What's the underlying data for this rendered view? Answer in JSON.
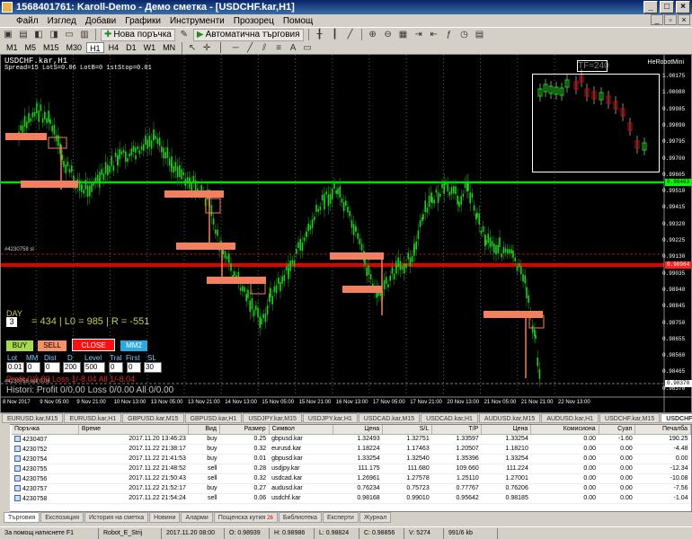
{
  "window": {
    "title": "1568401761: Karoll-Demo - Демо сметка - [USDCHF.kar,H1]"
  },
  "menu": [
    "Файл",
    "Изглед",
    "Добави",
    "Графики",
    "Инструменти",
    "Прозорец",
    "Помощ"
  ],
  "toolbar": {
    "new_order": "Нова поръчка",
    "auto_trading": "Автоматична търговия"
  },
  "timeframes": [
    "M1",
    "M5",
    "M15",
    "M30",
    "H1",
    "H4",
    "D1",
    "W1",
    "MN"
  ],
  "active_timeframe": "H1",
  "chart": {
    "title": "USDCHF.kar,H1",
    "spread_info": "Spread=15  LotS=0.06  LotB=0  1stStop=0.01",
    "robot_name": "HeRobotMini",
    "tf_box": "TF=240",
    "order_tag": "#4230758 sl",
    "order_tag2": "#4230758 sell 0.06",
    "day_label": "DAY",
    "day_value": "3",
    "stats": "= 434 | L0 = 985 | R = -551",
    "buttons": {
      "buy": "BUY",
      "sell": "SELL",
      "close": "CLOSE",
      "mm2": "MM2"
    },
    "params": [
      {
        "label": "Lot",
        "value": "0.01"
      },
      {
        "label": "MM",
        "value": "0"
      },
      {
        "label": "Dist",
        "value": "0"
      },
      {
        "label": "D",
        "value": "200"
      },
      {
        "label": "Level",
        "value": "500"
      },
      {
        "label": "Tral",
        "value": "0"
      },
      {
        "label": "First",
        "value": "0"
      },
      {
        "label": "SL",
        "value": "30"
      }
    ],
    "profit_line": "Profit 0/0.80  Loss 1/-8.04  All 1/-8.04",
    "history_line": "Histori: Profit 0/0.00  Loss 0/0.00  All 0/0.00",
    "price_labels": [
      "1.00175",
      "1.00080",
      "0.99985",
      "0.99890",
      "0.99795",
      "0.99700",
      "0.99605",
      "0.99510",
      "0.99415",
      "0.99320",
      "0.99225",
      "0.99130",
      "0.99035",
      "0.98940",
      "0.98845",
      "0.98750",
      "0.98655",
      "0.98560",
      "0.98465",
      "0.98370"
    ],
    "green_price": "0.99463",
    "red_price": "0.98964",
    "last_price": "0.98370",
    "date_labels": [
      "8 Nov 2017",
      "9 Nov 05:00",
      "9 Nov 21:00",
      "10 Nov 13:00",
      "13 Nov 05:00",
      "13 Nov 21:00",
      "14 Nov 13:00",
      "15 Nov 05:00",
      "15 Nov 21:00",
      "16 Nov 13:00",
      "17 Nov 05:00",
      "17 Nov 21:00",
      "20 Nov 13:00",
      "21 Nov 05:00",
      "21 Nov 21:00",
      "22 Nov 13:00"
    ]
  },
  "chart_tabs": [
    "EURUSD.kar,M15",
    "EURUSD.kar,H1",
    "GBPUSD.kar,M15",
    "GBPUSD.kar,H1",
    "USDJPY.kar,M15",
    "USDJPY.kar,H1",
    "USDCAD.kar,M15",
    "USDCAD.kar,H1",
    "AUDUSD.kar,M15",
    "AUDUSD.kar,H1",
    "USDCHF.kar,M15",
    "USDCHF.kar,H1"
  ],
  "active_chart_tab": "USDCHF.kar,H1",
  "orders": {
    "headers": [
      "Поръчка",
      "Време",
      "Вид",
      "Размер",
      "Символ",
      "Цена",
      "S/L",
      "T/P",
      "Цена",
      "Комисиона",
      "Суап",
      "Печалба"
    ],
    "rows": [
      [
        "4230407",
        "2017.11.20 13:46:23",
        "buy",
        "0.25",
        "gbpusd.kar",
        "1.32493",
        "1.32751",
        "1.33597",
        "1.33254",
        "0.00",
        "-1.60",
        "190.25"
      ],
      [
        "4230752",
        "2017.11.22 21:38:17",
        "buy",
        "0.32",
        "eurusd.kar",
        "1.18224",
        "1.17463",
        "1.20507",
        "1.18210",
        "0.00",
        "0.00",
        "-4.48"
      ],
      [
        "4230754",
        "2017.11.22 21:41:53",
        "buy",
        "0.01",
        "gbpusd.kar",
        "1.33254",
        "1.32540",
        "1.35396",
        "1.33254",
        "0.00",
        "0.00",
        "0.00"
      ],
      [
        "4230755",
        "2017.11.22 21:48:52",
        "sell",
        "0.28",
        "usdjpy.kar",
        "111.175",
        "111.680",
        "109.660",
        "111.224",
        "0.00",
        "0.00",
        "-12.34"
      ],
      [
        "4230756",
        "2017.11.22 21:50:43",
        "sell",
        "0.32",
        "usdcad.kar",
        "1.26961",
        "1.27578",
        "1.25110",
        "1.27001",
        "0.00",
        "0.00",
        "-10.08"
      ],
      [
        "4230757",
        "2017.11.22 21:52:17",
        "buy",
        "0.27",
        "audusd.kar",
        "0.76234",
        "0.75723",
        "0.77767",
        "0.76206",
        "0.00",
        "0.00",
        "-7.56"
      ],
      [
        "4230758",
        "2017.11.22 21:54:24",
        "sell",
        "0.06",
        "usdchf.kar",
        "0.98168",
        "0.99010",
        "0.95642",
        "0.98185",
        "0.00",
        "0.00",
        "-1.04"
      ]
    ]
  },
  "terminal_tabs": [
    "Търговия",
    "Експозиция",
    "История на сметка",
    "Новини",
    "Аларми",
    "Пощенска кутия",
    "Библиотека",
    "Експерти",
    "Журнал"
  ],
  "mailbox_badge": "26",
  "statusbar": [
    "За помощ натиснете F1",
    "Robot_E_Strij",
    "2017.11.20 08:00",
    "O: 0.98939",
    "H: 0.98986",
    "L: 0.98824",
    "C: 0.98856",
    "V: 5274",
    "991/6 kb"
  ]
}
